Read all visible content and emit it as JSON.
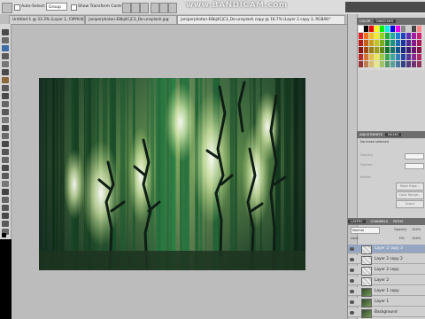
{
  "watermark": "www.BANDICAM.com",
  "options_bar": {
    "auto_select_label": "Auto-Select:",
    "auto_select_value": "Group",
    "transform_label": "Show Transform Controls"
  },
  "tabs": [
    {
      "label": "Untitled-1 @ 33.3% (Layer 1, CMYK/8)*"
    },
    {
      "label": "janiperphoton-E8bj4CjC3_De-unsplash.jpg"
    },
    {
      "label": "janiperphoton-E8bj4CjC3_De-unsplash copy @ 16.7% (Layer 2 copy 3, RGB/8)*"
    }
  ],
  "panels": {
    "color_tabs": [
      "COLOR",
      "SWATCHES"
    ],
    "adjust_tabs": [
      "ADJUSTMENTS",
      "MASKS"
    ],
    "masks_status": "No mask selected",
    "mask_fields": [
      "Density:",
      "Feather:",
      "Refine:"
    ],
    "mask_buttons": [
      "Mask Edge...",
      "Color Range...",
      "Invert"
    ],
    "layers_tabs": [
      "LAYERS",
      "CHANNELS",
      "PATHS"
    ],
    "blend_mode": "Normal",
    "opacity_label": "Opacity:",
    "opacity_value": "100%",
    "lock_label": "Lock:",
    "fill_label": "Fill:",
    "fill_value": "100%",
    "layers": [
      {
        "name": "Layer 2 copy 3",
        "selected": true,
        "thumb": "checker"
      },
      {
        "name": "Layer 2 copy 2",
        "selected": false,
        "thumb": "checker"
      },
      {
        "name": "Layer 2 copy",
        "selected": false,
        "thumb": "checker"
      },
      {
        "name": "Layer 2",
        "selected": false,
        "thumb": "checker"
      },
      {
        "name": "Layer 1 copy",
        "selected": false,
        "thumb": "green"
      },
      {
        "name": "Layer 1",
        "selected": false,
        "thumb": "green"
      },
      {
        "name": "Background",
        "selected": false,
        "thumb": "green"
      }
    ]
  },
  "colors": {
    "canvas_bg": "#bcbcbc",
    "selection": "#94a6c2",
    "forest_dark": "#1c3a2c",
    "forest_glow": "#d8f0a0"
  }
}
